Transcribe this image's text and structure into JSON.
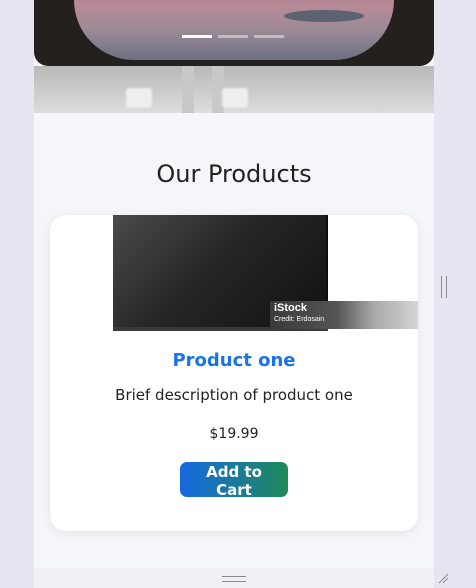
{
  "hero": {
    "slides": [
      {
        "state": "active"
      },
      {
        "state": "inactive"
      },
      {
        "state": "inactive"
      }
    ]
  },
  "products_section": {
    "title": "Our Products"
  },
  "products": [
    {
      "title": "Product one",
      "description": "Brief description of product one",
      "price": "$19.99",
      "button_label": "Add to Cart",
      "image": {
        "watermark_brand": "iStock",
        "watermark_credit": "Credit: Erdosain"
      }
    }
  ],
  "colors": {
    "title_blue": "#1a73e8",
    "button_gradient_start": "#1769e0",
    "button_gradient_end": "#1f8a5a",
    "page_background": "#f5f6f9"
  },
  "icons": {
    "resize": "resize-grip-icon",
    "scroll_handle": "scroll-grip-icon"
  }
}
